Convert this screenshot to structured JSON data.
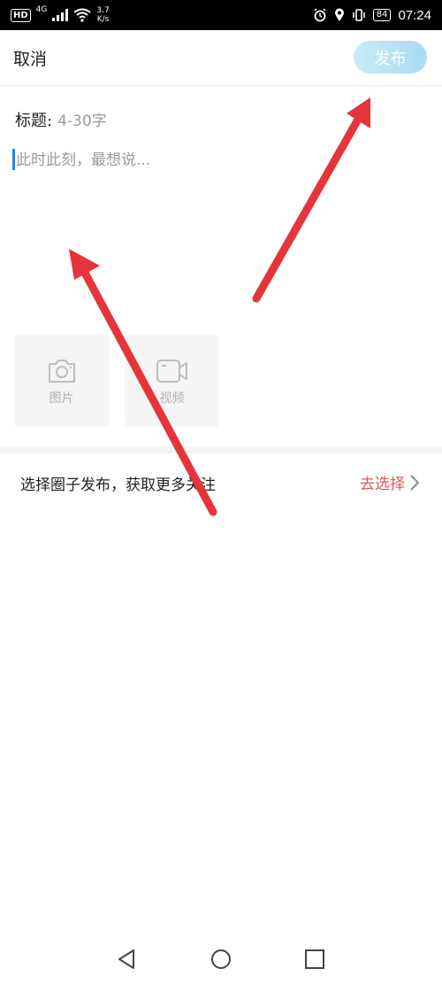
{
  "status_bar": {
    "hd": "HD",
    "network": "4G",
    "speed_value": "3.7",
    "speed_unit": "K/s",
    "battery": "84",
    "time": "07:24"
  },
  "header": {
    "cancel_label": "取消",
    "publish_label": "发布"
  },
  "editor": {
    "title_label": "标题:",
    "title_placeholder": "4-30字",
    "body_placeholder": "此时此刻，最想说..."
  },
  "media": {
    "photo_label": "图片",
    "video_label": "视频"
  },
  "circle": {
    "prompt": "选择圈子发布，获取更多关注",
    "action": "去选择"
  },
  "colors": {
    "publish_gradient": [
      "#c9ecf6",
      "#a8daf1"
    ],
    "accent_red": "#e0555a",
    "caret": "#1e88e5",
    "annotation_arrow": "#e5343a"
  },
  "icons": [
    "camera-icon",
    "video-icon",
    "chevron-right-icon",
    "back-nav-icon",
    "home-nav-icon",
    "recents-nav-icon"
  ]
}
